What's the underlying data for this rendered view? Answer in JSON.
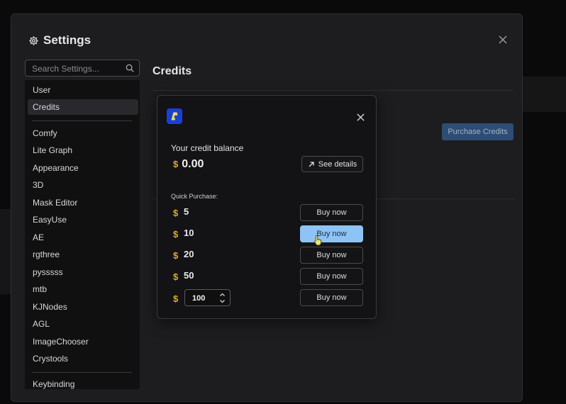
{
  "settings": {
    "title": "Settings",
    "search_placeholder": "Search Settings...",
    "nav_group_1": [
      "User",
      "Credits"
    ],
    "nav_group_2": [
      "Comfy",
      "Lite Graph",
      "Appearance",
      "3D",
      "Mask Editor",
      "EasyUse",
      "AE",
      "rgthree",
      "pysssss",
      "mtb",
      "KJNodes",
      "AGL",
      "ImageChooser",
      "Crystools"
    ],
    "nav_group_3": [
      "Keybinding"
    ],
    "active_item": "Credits"
  },
  "credits_page": {
    "title": "Credits",
    "purchase_button": "Purchase Credits"
  },
  "modal": {
    "balance_label": "Your credit balance",
    "currency_symbol": "$",
    "balance_value": "0.00",
    "see_details": "See details",
    "quick_purchase_label": "Quick Purchase:",
    "options": [
      {
        "amount": "5",
        "button": "Buy now"
      },
      {
        "amount": "10",
        "button": "Buy now"
      },
      {
        "amount": "20",
        "button": "Buy now"
      },
      {
        "amount": "50",
        "button": "Buy now"
      }
    ],
    "custom_amount": "100",
    "custom_button": "Buy now",
    "hovered_option": "10"
  },
  "colors": {
    "accent": "#8ec3f5",
    "currency": "#e5a92e",
    "logo": "#1b3fd6",
    "primary_button": "#2e4d75"
  }
}
